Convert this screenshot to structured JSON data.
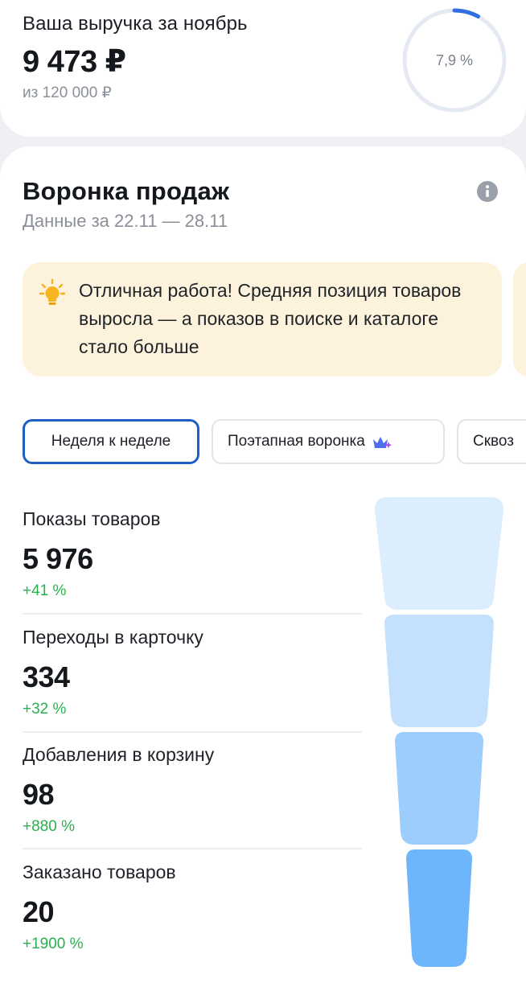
{
  "revenue": {
    "title": "Ваша выручка за ноябрь",
    "amount": "9 473 ₽",
    "target": "из 120 000 ₽",
    "progress_label": "7,9 %",
    "progress_fraction": 0.079,
    "ring_track_color": "#e4e9f2",
    "ring_fill_color": "#2f6fe0"
  },
  "funnel": {
    "title": "Воронка продаж",
    "subtitle": "Данные за 22.11 — 28.11",
    "info_icon": "info-icon",
    "tip": {
      "icon": "bulb-icon",
      "text": "Отличная работа! Средняя позиция товаров выросла — а показов в поиске и каталоге стало больше"
    },
    "chips": [
      {
        "label": "Неделя к неделе",
        "active": true
      },
      {
        "label": "Поэтапная воронка",
        "active": false,
        "icon": "sparkle-icon"
      },
      {
        "label": "Сквоз",
        "active": false
      }
    ],
    "metrics": [
      {
        "label": "Показы товаров",
        "value": "5 976",
        "delta": "+41 %",
        "color": "#dcedfd"
      },
      {
        "label": "Переходы в карточку",
        "value": "334",
        "delta": "+32 %",
        "color": "#c3e0fc"
      },
      {
        "label": "Добавления в корзину",
        "value": "98",
        "delta": "+880 %",
        "color": "#9dcdfc"
      },
      {
        "label": "Заказано товаров",
        "value": "20",
        "delta": "+1900 %",
        "color": "#6db6fb"
      }
    ]
  }
}
